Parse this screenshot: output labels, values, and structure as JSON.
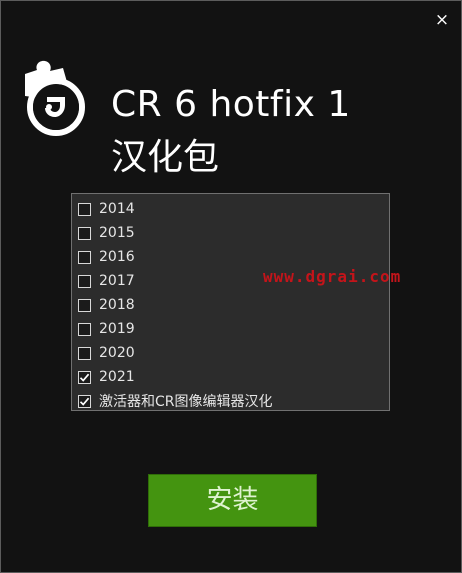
{
  "window": {
    "close_glyph": "×"
  },
  "title": {
    "line1": "CR 6 hotfix 1",
    "line2": "汉化包"
  },
  "options": [
    {
      "label": "2014",
      "checked": false
    },
    {
      "label": "2015",
      "checked": false
    },
    {
      "label": "2016",
      "checked": false
    },
    {
      "label": "2017",
      "checked": false
    },
    {
      "label": "2018",
      "checked": false
    },
    {
      "label": "2019",
      "checked": false
    },
    {
      "label": "2020",
      "checked": false
    },
    {
      "label": "2021",
      "checked": true
    },
    {
      "label": "激活器和CR图像编辑器汉化",
      "checked": true
    }
  ],
  "watermark": "www.dgrai.com",
  "install_button": {
    "label": "安装"
  },
  "colors": {
    "background": "#121212",
    "list_background": "#2c2c2c",
    "install_button": "#449410",
    "watermark": "#c4141a"
  },
  "icons": {
    "logo": "puzzle-piece-c-logo-icon",
    "close": "close-icon",
    "check": "checkmark-icon"
  }
}
